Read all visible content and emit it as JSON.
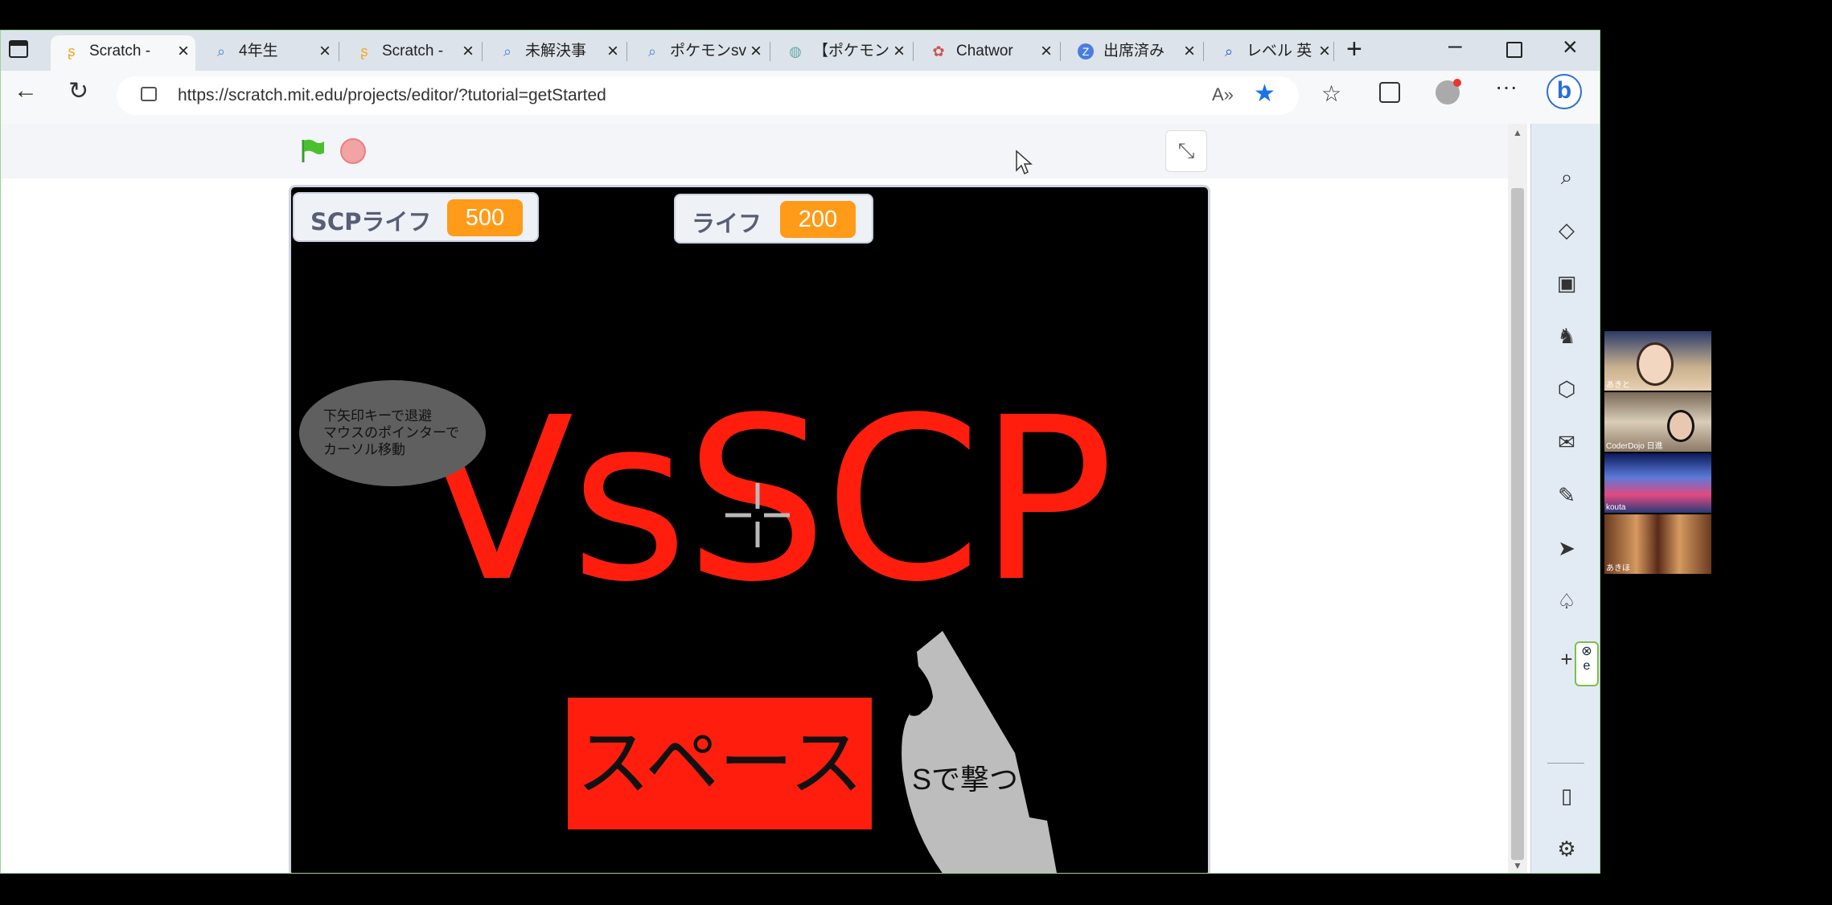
{
  "tabs": [
    {
      "label": "Scratch -",
      "icon": "scratch-icon",
      "active": true
    },
    {
      "label": "4年生",
      "icon": "search-icon"
    },
    {
      "label": "Scratch -",
      "icon": "scratch-icon"
    },
    {
      "label": "未解決事",
      "icon": "search-icon"
    },
    {
      "label": "ポケモンsv",
      "icon": "search-icon"
    },
    {
      "label": "【ポケモン",
      "icon": "page-icon"
    },
    {
      "label": "Chatwor",
      "icon": "chatwork-icon"
    },
    {
      "label": "出席済み",
      "icon": "zoom-icon"
    },
    {
      "label": "レベル 英",
      "icon": "search-icon"
    }
  ],
  "address": {
    "url": "https://scratch.mit.edu/projects/editor/?tutorial=getStarted"
  },
  "monitors": {
    "scp": {
      "label": "SCPライフ",
      "value": "500"
    },
    "life": {
      "label": "ライフ",
      "value": "200"
    }
  },
  "stage": {
    "title": "VsSCP",
    "bubble_lines": [
      "下矢印キーで退避",
      "マウスのポインターで",
      "カーソル移動"
    ],
    "space_label": "スペース",
    "shoot_label": "Sで撃つ"
  },
  "participants": [
    {
      "name": "あきと"
    },
    {
      "name": "CoderDojo 日進"
    },
    {
      "name": "kouta"
    },
    {
      "name": "あきほ"
    }
  ],
  "colors": {
    "accent_red": "#ff1e0d",
    "monitor_orange": "#ff9b18",
    "stage_bg": "#000000"
  }
}
